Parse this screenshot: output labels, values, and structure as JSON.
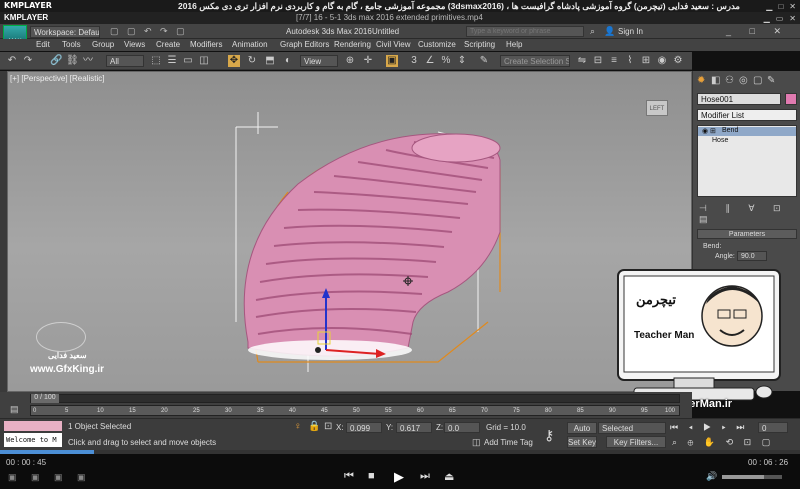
{
  "player": {
    "logo": "KMPLAYER",
    "title": "مجموعه آموزشی جامع ، گام به گام و کاربردی نرم افزار تری دی مکس 2016 (3dsmax2016) ، مدرس : سعید فدایی (تیچرمن) گروه آموزشی پادشاه گرافیست ها",
    "file_label": "[7/7] 16 - 5-1 3ds max 2016 extended primitives.mp4",
    "time_current": "00 : 00 : 45",
    "time_total": "00 : 06 : 26",
    "controls": [
      "⏮",
      "■",
      "▶",
      "⏭",
      "⏏"
    ]
  },
  "max": {
    "logo": "MAX",
    "workspace": "Workspace: Default",
    "app_title": "Autodesk 3ds Max 2016",
    "doc_title": "Untitled",
    "search_placeholder": "Type a keyword or phrase",
    "sign_in": "Sign In",
    "menus": [
      "Edit",
      "Tools",
      "Group",
      "Views",
      "Create",
      "Modifiers",
      "Animation",
      "Graph Editors",
      "Rendering",
      "Civil View",
      "Customize",
      "Scripting",
      "Help"
    ],
    "filter": "All",
    "ref_coord": "View",
    "selection_set": "Create Selection Se",
    "viewport_label": "[+] [Perspective] [Realistic]",
    "viewcube": "LEFT"
  },
  "command_panel": {
    "object_name": "Hose001",
    "modifier_list": "Modifier List",
    "stack": [
      "Bend",
      "Hose"
    ],
    "rollout": "Parameters",
    "bend_label": "Bend:",
    "angle_label": "Angle:",
    "angle_value": "90.0"
  },
  "timeline": {
    "frame": "0 / 100",
    "ticks": [
      "0",
      "5",
      "10",
      "15",
      "20",
      "25",
      "30",
      "35",
      "40",
      "45",
      "50",
      "55",
      "60",
      "65",
      "70",
      "75",
      "80",
      "85",
      "90",
      "95",
      "100"
    ]
  },
  "status": {
    "listener": "Welcome to M",
    "selected": "1 Object Selected",
    "prompt": "Click and drag to select and move objects",
    "x_label": "X:",
    "x_value": "0.099",
    "y_label": "Y:",
    "y_value": "0.617",
    "z_label": "Z:",
    "z_value": "0.0",
    "grid": "Grid = 10.0",
    "add_time_tag": "Add Time Tag",
    "auto_key": "Auto Key",
    "selected_dd": "Selected",
    "set_key": "Set Key",
    "key_filters": "Key Filters...",
    "frame_field": "0"
  },
  "watermarks": {
    "author": "سعید فدایی",
    "site_left": "www.GfxKing.ir",
    "site_right": "www.TeacherMan.ir",
    "teacher_name": "Teacher Man",
    "teacher_fa": "تیچرمن"
  },
  "colors": {
    "hose": "#d98fb3",
    "selection": "#e08a1e",
    "gizmo_x": "#d22",
    "gizmo_z": "#22c"
  }
}
